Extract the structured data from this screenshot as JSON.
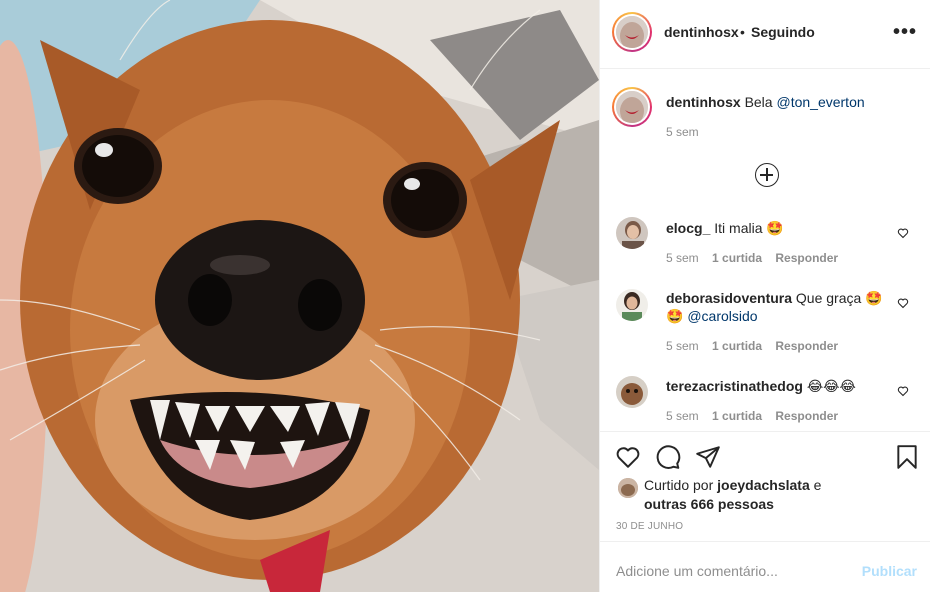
{
  "post": {
    "username": "dentinhosx",
    "separator": "•",
    "follow_status": "Seguindo",
    "more_label": "•••",
    "image_alt": "dog-photo"
  },
  "caption": {
    "username": "dentinhosx",
    "text": "Bela",
    "mention": "@ton_everton",
    "time": "5 sem"
  },
  "comments": [
    {
      "username": "elocg_",
      "text": "Iti malia 🤩",
      "time": "5 sem",
      "likes": "1 curtida",
      "reply": "Responder"
    },
    {
      "username": "deborasidoventura",
      "text": "Que graça 🤩",
      "text2": "🤩",
      "mention": "@carolsido",
      "time": "5 sem",
      "likes": "1 curtida",
      "reply": "Responder"
    },
    {
      "username": "terezacristinathedog",
      "text": "😂😂😂",
      "time": "5 sem",
      "likes": "1 curtida",
      "reply": "Responder"
    }
  ],
  "likes": {
    "prefix": "Curtido por",
    "user": "joeydachslata",
    "and": "e",
    "others": "outras 666 pessoas"
  },
  "date": "30 DE JUNHO",
  "add_comment": {
    "placeholder": "Adicione um comentário...",
    "publish": "Publicar"
  },
  "colors": {
    "link": "#00376b",
    "muted": "#8e8e8e",
    "publish_disabled": "#b2dffc"
  }
}
